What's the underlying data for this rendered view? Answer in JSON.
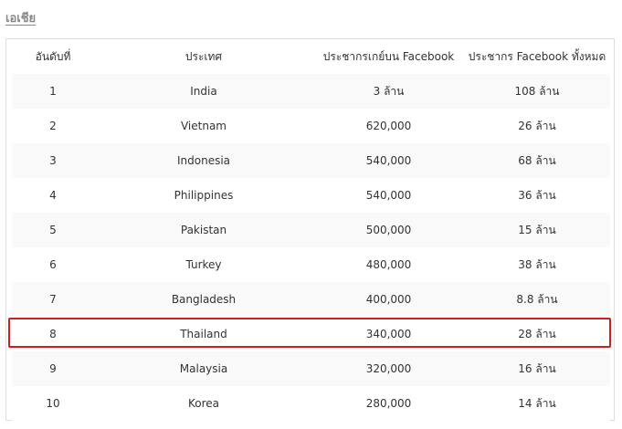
{
  "heading": "เอเชีย",
  "columns": [
    "อันดับที่",
    "ประเทศ",
    "ประชากรเกย์บน Facebook",
    "ประชากร Facebook ทั้งหมด"
  ],
  "rows": [
    {
      "rank": "1",
      "country": "India",
      "gay_pop": "3 ล้าน",
      "total_pop": "108 ล้าน"
    },
    {
      "rank": "2",
      "country": "Vietnam",
      "gay_pop": "620,000",
      "total_pop": "26 ล้าน"
    },
    {
      "rank": "3",
      "country": "Indonesia",
      "gay_pop": "540,000",
      "total_pop": "68 ล้าน"
    },
    {
      "rank": "4",
      "country": "Philippines",
      "gay_pop": "540,000",
      "total_pop": "36 ล้าน"
    },
    {
      "rank": "5",
      "country": "Pakistan",
      "gay_pop": "500,000",
      "total_pop": "15 ล้าน"
    },
    {
      "rank": "6",
      "country": "Turkey",
      "gay_pop": "480,000",
      "total_pop": "38 ล้าน"
    },
    {
      "rank": "7",
      "country": "Bangladesh",
      "gay_pop": "400,000",
      "total_pop": "8.8 ล้าน"
    },
    {
      "rank": "8",
      "country": "Thailand",
      "gay_pop": "340,000",
      "total_pop": "28 ล้าน"
    },
    {
      "rank": "9",
      "country": "Malaysia",
      "gay_pop": "320,000",
      "total_pop": "16 ล้าน"
    },
    {
      "rank": "10",
      "country": "Korea",
      "gay_pop": "280,000",
      "total_pop": "14 ล้าน"
    }
  ],
  "highlight_color": "#cc1f1f"
}
